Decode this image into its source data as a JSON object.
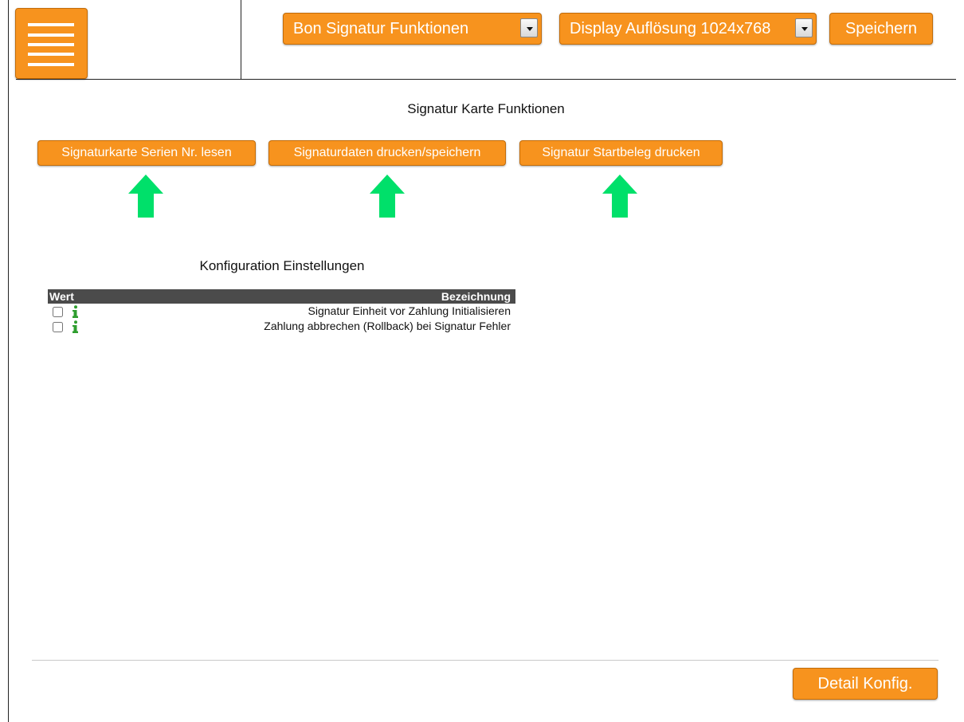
{
  "header": {
    "function_select": {
      "value": "Bon Signatur Funktionen"
    },
    "display_select": {
      "value": "Display Auflösung 1024x768"
    },
    "save_label": "Speichern"
  },
  "card_section": {
    "title": "Signatur Karte Funktionen",
    "buttons": [
      {
        "label": "Signaturkarte Serien Nr. lesen"
      },
      {
        "label": "Signaturdaten drucken/speichern"
      },
      {
        "label": "Signatur Startbeleg drucken"
      }
    ]
  },
  "config_section": {
    "title": "Konfiguration Einstellungen",
    "columns": {
      "value": "Wert",
      "description": "Bezeichnung"
    },
    "rows": [
      {
        "checked": false,
        "description": "Signatur Einheit vor Zahlung Initialisieren"
      },
      {
        "checked": false,
        "description": "Zahlung abbrechen (Rollback) bei Signatur Fehler"
      }
    ]
  },
  "footer": {
    "detail_label": "Detail Konfig."
  },
  "colors": {
    "accent": "#f7931e",
    "arrow": "#00e06a",
    "table_header": "#4b4b4b",
    "info_icon": "#2e9d2e"
  },
  "icons": {
    "menu": "hamburger-menu-icon",
    "arrow": "arrow-up-icon",
    "info": "info-icon",
    "dropdown": "chevron-down-icon"
  }
}
